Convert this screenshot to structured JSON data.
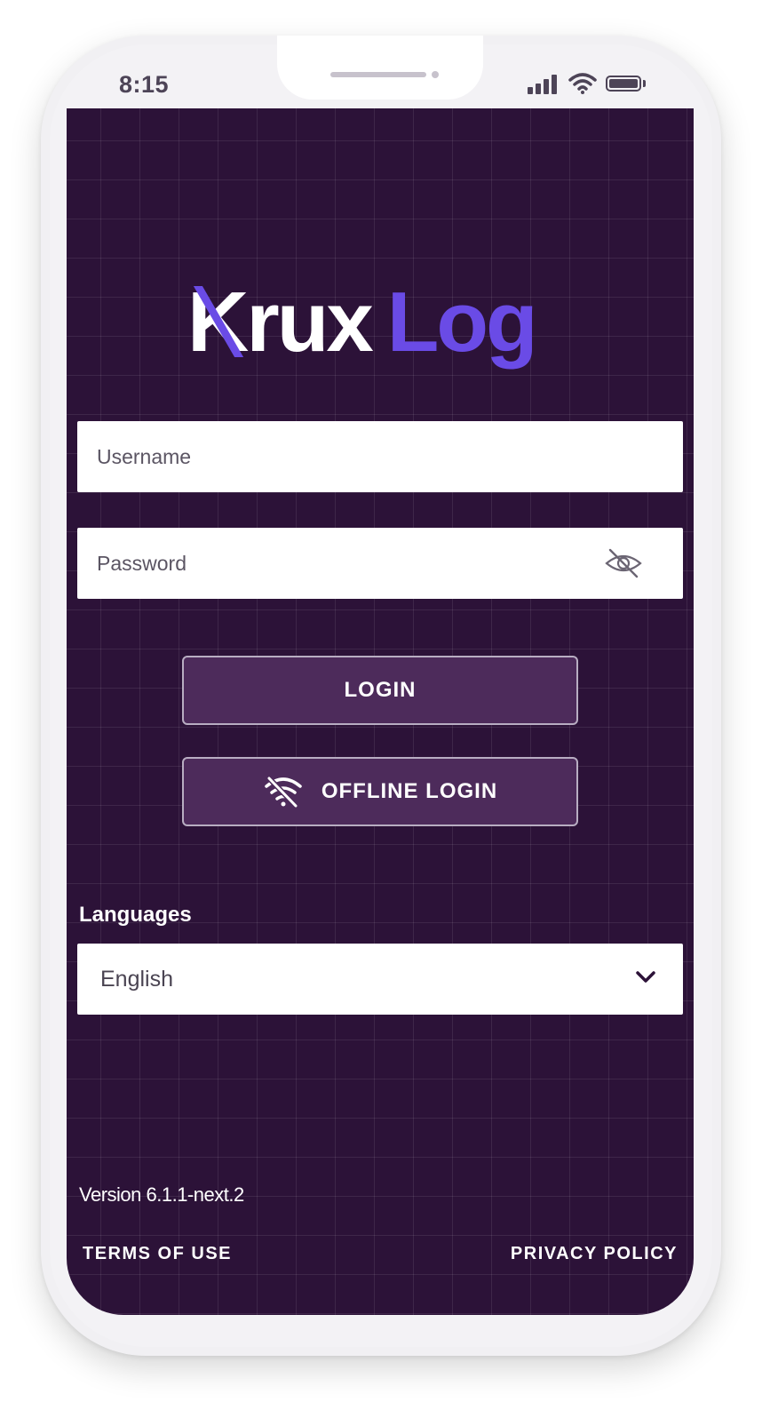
{
  "status_bar": {
    "time": "8:15"
  },
  "logo": {
    "part1": "Krux",
    "part2": "Log"
  },
  "form": {
    "username_placeholder": "Username",
    "password_placeholder": "Password"
  },
  "buttons": {
    "login": "LOGIN",
    "offline_login": "OFFLINE LOGIN"
  },
  "languages": {
    "label": "Languages",
    "selected": "English"
  },
  "footer": {
    "version": "Version 6.1.1-next.2",
    "terms": "TERMS OF USE",
    "privacy": "PRIVACY POLICY"
  },
  "colors": {
    "background": "#2c1238",
    "accent": "#6a4be6",
    "button": "#4d2b5b"
  },
  "icons": [
    "eye-off-icon",
    "wifi-off-icon",
    "chevron-down-icon",
    "signal-icon",
    "wifi-icon",
    "battery-icon"
  ]
}
